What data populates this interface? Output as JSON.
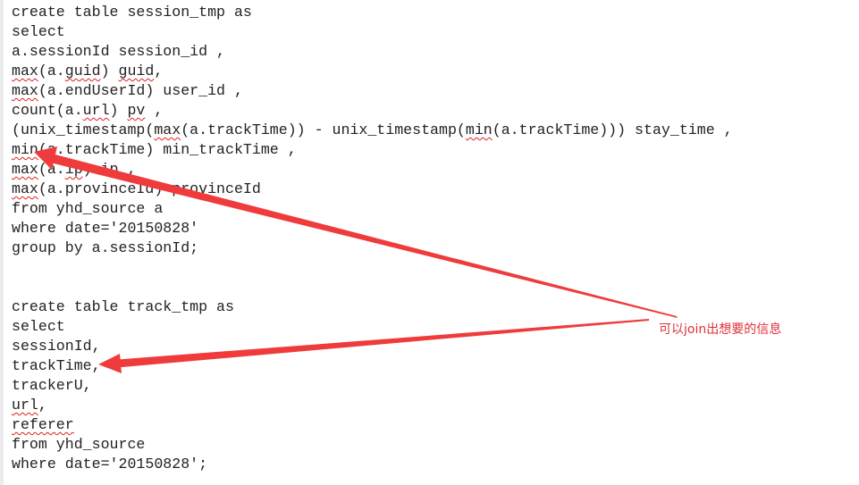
{
  "code_lines": [
    [
      {
        "t": "create table session_tmp as"
      }
    ],
    [
      {
        "t": "select"
      }
    ],
    [
      {
        "t": "a.sessionId session_id ,"
      }
    ],
    [
      {
        "t": "max",
        "s": 1
      },
      {
        "t": "(a."
      },
      {
        "t": "guid",
        "s": 1
      },
      {
        "t": ") "
      },
      {
        "t": "guid",
        "s": 1
      },
      {
        "t": ","
      }
    ],
    [
      {
        "t": "max",
        "s": 1
      },
      {
        "t": "(a.endUserId) user_id ,"
      }
    ],
    [
      {
        "t": "count(a."
      },
      {
        "t": "url",
        "s": 1
      },
      {
        "t": ") "
      },
      {
        "t": "pv",
        "s": 1
      },
      {
        "t": " ,"
      }
    ],
    [
      {
        "t": "(unix_timestamp("
      },
      {
        "t": "max",
        "s": 1
      },
      {
        "t": "(a.trackTime)) - unix_timestamp("
      },
      {
        "t": "min",
        "s": 1
      },
      {
        "t": "(a.trackTime))) stay_time ,"
      }
    ],
    [
      {
        "t": "min",
        "s": 1
      },
      {
        "t": "(a.trackTime) min_trackTime ,"
      }
    ],
    [
      {
        "t": "max",
        "s": 1
      },
      {
        "t": "(a."
      },
      {
        "t": "ip",
        "s": 1
      },
      {
        "t": ") ip ,"
      }
    ],
    [
      {
        "t": "max",
        "s": 1
      },
      {
        "t": "(a.provinceId) provinceId"
      }
    ],
    [
      {
        "t": "from yhd_source a"
      }
    ],
    [
      {
        "t": "where date='20150828'"
      }
    ],
    [
      {
        "t": "group by a.sessionId;"
      }
    ],
    [
      {
        "t": ""
      }
    ],
    [
      {
        "t": ""
      }
    ],
    [
      {
        "t": "create table track_tmp as"
      }
    ],
    [
      {
        "t": "select"
      }
    ],
    [
      {
        "t": "sessionId,"
      }
    ],
    [
      {
        "t": "trackTime,"
      }
    ],
    [
      {
        "t": "trackerU,"
      }
    ],
    [
      {
        "t": "url",
        "s": 1
      },
      {
        "t": ","
      }
    ],
    [
      {
        "t": "referer",
        "s": 1
      },
      {
        "t": ""
      }
    ],
    [
      {
        "t": "from yhd_source"
      }
    ],
    [
      {
        "t": "where date='20150828';"
      }
    ]
  ],
  "annotation": {
    "text": "可以join出想要的信息",
    "color": "#e8353f"
  }
}
